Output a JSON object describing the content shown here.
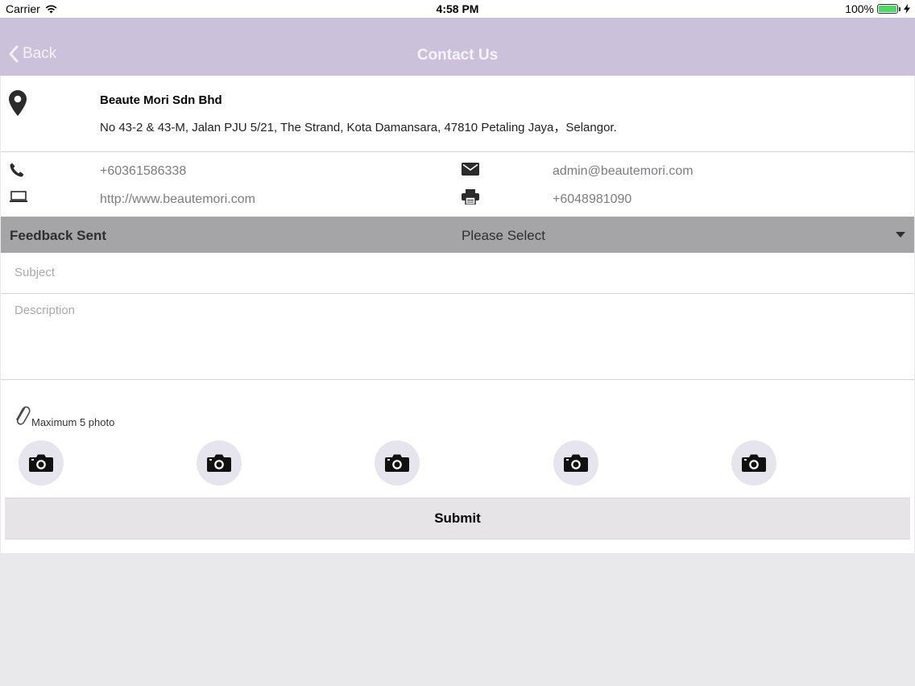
{
  "status_bar": {
    "carrier": "Carrier",
    "time": "4:58 PM",
    "battery": "100%"
  },
  "nav": {
    "back_label": "Back",
    "title": "Contact Us"
  },
  "company": {
    "name": "Beaute Mori Sdn Bhd",
    "address": "No 43-2 & 43-M, Jalan PJU 5/21, The Strand, Kota Damansara, 47810 Petaling Jaya，Selangor."
  },
  "contact": {
    "phone": "+60361586338",
    "email": "admin@beautemori.com",
    "website": "http://www.beautemori.com",
    "fax": "+6048981090"
  },
  "feedback": {
    "label": "Feedback Sent",
    "select_value": "Please Select"
  },
  "form": {
    "subject_placeholder": "Subject",
    "description_placeholder": "Description",
    "photo_hint": "Maximum 5 photo",
    "submit_label": "Submit"
  },
  "colors": {
    "nav_bg": "#cbc1da",
    "feedback_bar_bg": "#a5a4a7",
    "camera_bg": "#e6e4ec",
    "battery": "#4cd964"
  },
  "icons": [
    "location-pin-icon",
    "phone-icon",
    "email-icon",
    "monitor-icon",
    "printer-icon",
    "paperclip-icon",
    "camera-icon"
  ]
}
